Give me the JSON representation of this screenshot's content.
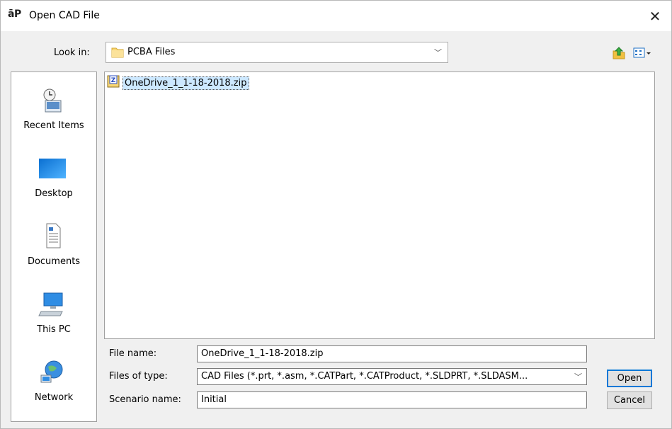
{
  "window": {
    "logo": "āP",
    "title": "Open CAD File",
    "close_glyph": "✕"
  },
  "lookin": {
    "label": "Look in:",
    "value": "PCBA Files",
    "arrow": "﹀"
  },
  "toolbar": {
    "up_icon": "up-folder-icon",
    "view_icon": "view-menu-icon"
  },
  "places": [
    {
      "label": "Recent Items",
      "icon": "recent-items-icon"
    },
    {
      "label": "Desktop",
      "icon": "desktop-icon"
    },
    {
      "label": "Documents",
      "icon": "documents-icon"
    },
    {
      "label": "This PC",
      "icon": "this-pc-icon"
    },
    {
      "label": "Network",
      "icon": "network-icon"
    }
  ],
  "files": [
    {
      "name": "OneDrive_1_1-18-2018.zip",
      "icon": "zip-file-icon",
      "selected": true
    }
  ],
  "form": {
    "filename_label": "File name:",
    "filename_value": "OneDrive_1_1-18-2018.zip",
    "filetype_label": "Files of type:",
    "filetype_value": "CAD Files (*.prt, *.asm, *.CATPart, *.CATProduct, *.SLDPRT, *.SLDASM...",
    "scenario_label": "Scenario name:",
    "scenario_value": "Initial"
  },
  "buttons": {
    "open": "Open",
    "cancel": "Cancel"
  },
  "colors": {
    "selection": "#cce8ff",
    "default_button_border": "#0078d7",
    "folder": "#f8d775"
  }
}
